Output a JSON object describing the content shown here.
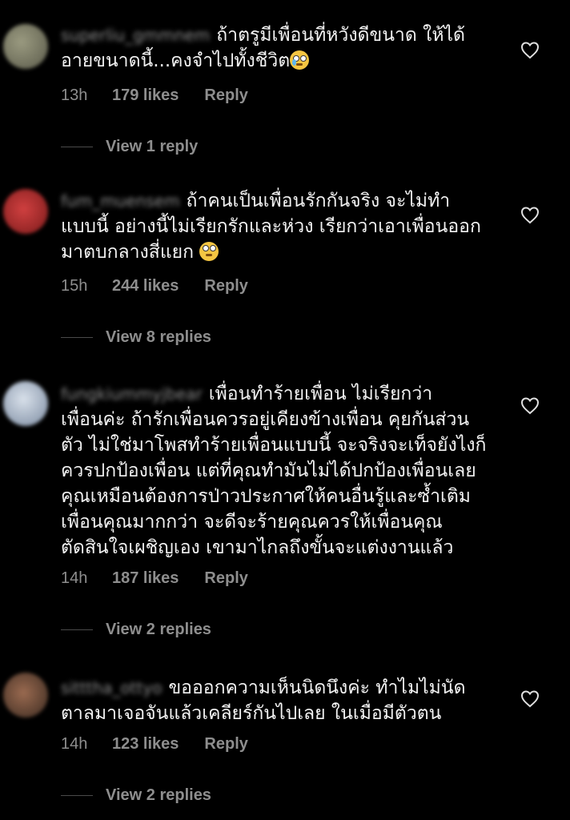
{
  "comments": [
    {
      "username": "superliu_gmmnem",
      "text_line1": "ถ้าตรูมีเพื่อนที่หวังดีขนาด ให้ได้",
      "text_rest": "อายขนาดนี้...คงจำไปทั้งชีวิต",
      "emoji": "crying-face",
      "time": "13h",
      "likes": "179 likes",
      "reply": "Reply",
      "view_replies": "View 1 reply",
      "avatar_color": "#7a7a6a"
    },
    {
      "username": "fum_muensem",
      "text_line1": "ถ้าคนเป็นเพื่อนรักกันจริง จะไม่ทำ",
      "text_rest": "แบบนี้ อย่างนี้ไม่เรียกรักและห่วง เรียกว่าเอาเพื่อนออก\nมาตบกลางสี่แยก",
      "emoji": "eye-roll-face",
      "time": "15h",
      "likes": "244 likes",
      "reply": "Reply",
      "view_replies": "View 8 replies",
      "avatar_color": "#b03030"
    },
    {
      "username": "fungkiummyjbear",
      "text_line1": "เพื่อนทำร้ายเพื่อน ไม่เรียกว่า",
      "text_rest": "เพื่อนค่ะ ถ้ารักเพื่อนควรอยู่เคียงข้างเพื่อน คุยกันส่วน\nตัว ไม่ใช่มาโพสทำร้ายเพื่อนแบบนี้ จะจริงจะเท็จยังไงก็\nควรปกป้องเพื่อน แต่ที่คุณทำมันไม่ได้ปกป้องเพื่อนเลย\nคุณเหมือนต้องการป่าวประกาศให้คนอื่นรู้และซ้ำเติม\nเพื่อนคุณมากกว่า จะดีจะร้ายคุณควรให้เพื่อนคุณ\nตัดสินใจเผชิญเอง เขามาไกลถึงขั้นจะแต่งงานแล้ว",
      "emoji": "",
      "time": "14h",
      "likes": "187 likes",
      "reply": "Reply",
      "view_replies": "View 2 replies",
      "avatar_color": "#a8b4c4"
    },
    {
      "username": "sitttha_ottyo",
      "text_line1": "ขอออกความเห็นนิดนึงค่ะ ทำไมไม่นัด",
      "text_rest": "ตาลมาเจอจันแล้วเคลียร์กันไปเลย ในเมื่อมีตัวตน",
      "emoji": "",
      "time": "14h",
      "likes": "123 likes",
      "reply": "Reply",
      "view_replies": "View 2 replies",
      "avatar_color": "#6a4a3a"
    }
  ]
}
